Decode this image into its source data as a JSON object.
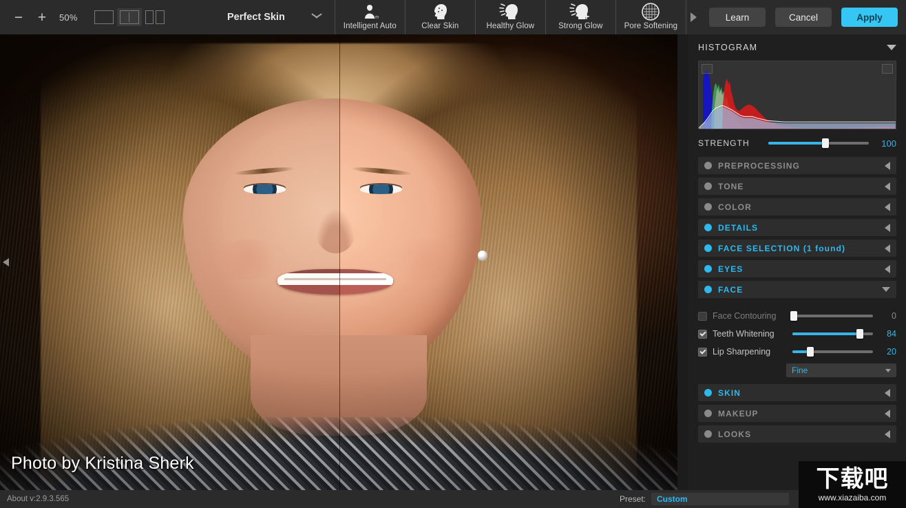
{
  "app": {
    "title": "Perfect Skin",
    "version_label": "About v:2.9.3.565"
  },
  "toolbar": {
    "zoom_out_icon": "minus-icon",
    "zoom_in_icon": "plus-icon",
    "zoom_level": "50%",
    "view_modes": [
      {
        "name": "single-view",
        "selected": false
      },
      {
        "name": "split-view",
        "selected": true
      },
      {
        "name": "side-by-side-view",
        "selected": false
      }
    ],
    "module_name": "Perfect Skin",
    "module_dropdown_icon": "chevron-down-icon",
    "presets": [
      {
        "label": "Intelligent Auto",
        "icon": "face-auto-icon"
      },
      {
        "label": "Clear Skin",
        "icon": "face-clear-icon"
      },
      {
        "label": "Healthy Glow",
        "icon": "face-glow-icon"
      },
      {
        "label": "Strong Glow",
        "icon": "face-strong-glow-icon"
      },
      {
        "label": "Pore Softening",
        "icon": "pore-grid-icon"
      }
    ],
    "presets_next_icon": "triangle-right-icon",
    "learn_label": "Learn",
    "cancel_label": "Cancel",
    "apply_label": "Apply"
  },
  "canvas": {
    "photo_credit": "Photo by Kristina Sherk",
    "left_panel_toggle_icon": "triangle-left-icon",
    "right_panel_toggle_icon": "triangle-right-icon"
  },
  "panel": {
    "histogram": {
      "title": "HISTOGRAM",
      "collapse_icon": "caret-down-icon",
      "shadow_clip_name": "shadow-clipping-toggle",
      "highlight_clip_name": "highlight-clipping-toggle"
    },
    "strength": {
      "label": "STRENGTH",
      "value": 100,
      "percent": 57
    },
    "sections": [
      {
        "id": "preprocessing",
        "label": "PREPROCESSING",
        "active": false,
        "open": false,
        "caret": "caret-left-icon"
      },
      {
        "id": "tone",
        "label": "TONE",
        "active": false,
        "open": false,
        "caret": "caret-left-icon"
      },
      {
        "id": "color",
        "label": "COLOR",
        "active": false,
        "open": false,
        "caret": "caret-left-icon"
      },
      {
        "id": "details",
        "label": "DETAILS",
        "active": true,
        "open": false,
        "caret": "caret-left-icon"
      },
      {
        "id": "face-selection",
        "label": "FACE SELECTION (1 found)",
        "active": true,
        "open": false,
        "caret": "caret-left-icon"
      },
      {
        "id": "eyes",
        "label": "EYES",
        "active": true,
        "open": false,
        "caret": "caret-left-icon"
      },
      {
        "id": "face",
        "label": "FACE",
        "active": true,
        "open": true,
        "caret": "caret-down-icon"
      }
    ],
    "face_controls": [
      {
        "id": "face-contouring",
        "label": "Face Contouring",
        "checked": false,
        "value": 0,
        "percent": 2
      },
      {
        "id": "teeth-whitening",
        "label": "Teeth Whitening",
        "checked": true,
        "value": 84,
        "percent": 84
      },
      {
        "id": "lip-sharpening",
        "label": "Lip Sharpening",
        "checked": true,
        "value": 20,
        "percent": 22
      }
    ],
    "face_quality": {
      "label": "Fine",
      "caret": "caret-down-icon"
    },
    "sections_bottom": [
      {
        "id": "skin",
        "label": "SKIN",
        "active": true,
        "open": false,
        "caret": "caret-left-icon"
      },
      {
        "id": "makeup",
        "label": "MAKEUP",
        "active": false,
        "open": false,
        "caret": "caret-left-icon"
      },
      {
        "id": "looks",
        "label": "LOOKS",
        "active": false,
        "open": false,
        "caret": "caret-left-icon"
      }
    ]
  },
  "statusbar": {
    "about": "About v:2.9.3.565",
    "preset_label": "Preset:",
    "preset_value": "Custom"
  },
  "watermark": {
    "cn": "下载吧",
    "url": "www.xiazaiba.com"
  },
  "colors": {
    "accent": "#2bb9ef",
    "slider_fill": "#3ab4e8",
    "apply_button": "#35c6f4",
    "panel_bg": "#1f1f1f",
    "toolbar_bg": "#2b2b2b",
    "section_bg": "#2d2d2d"
  }
}
